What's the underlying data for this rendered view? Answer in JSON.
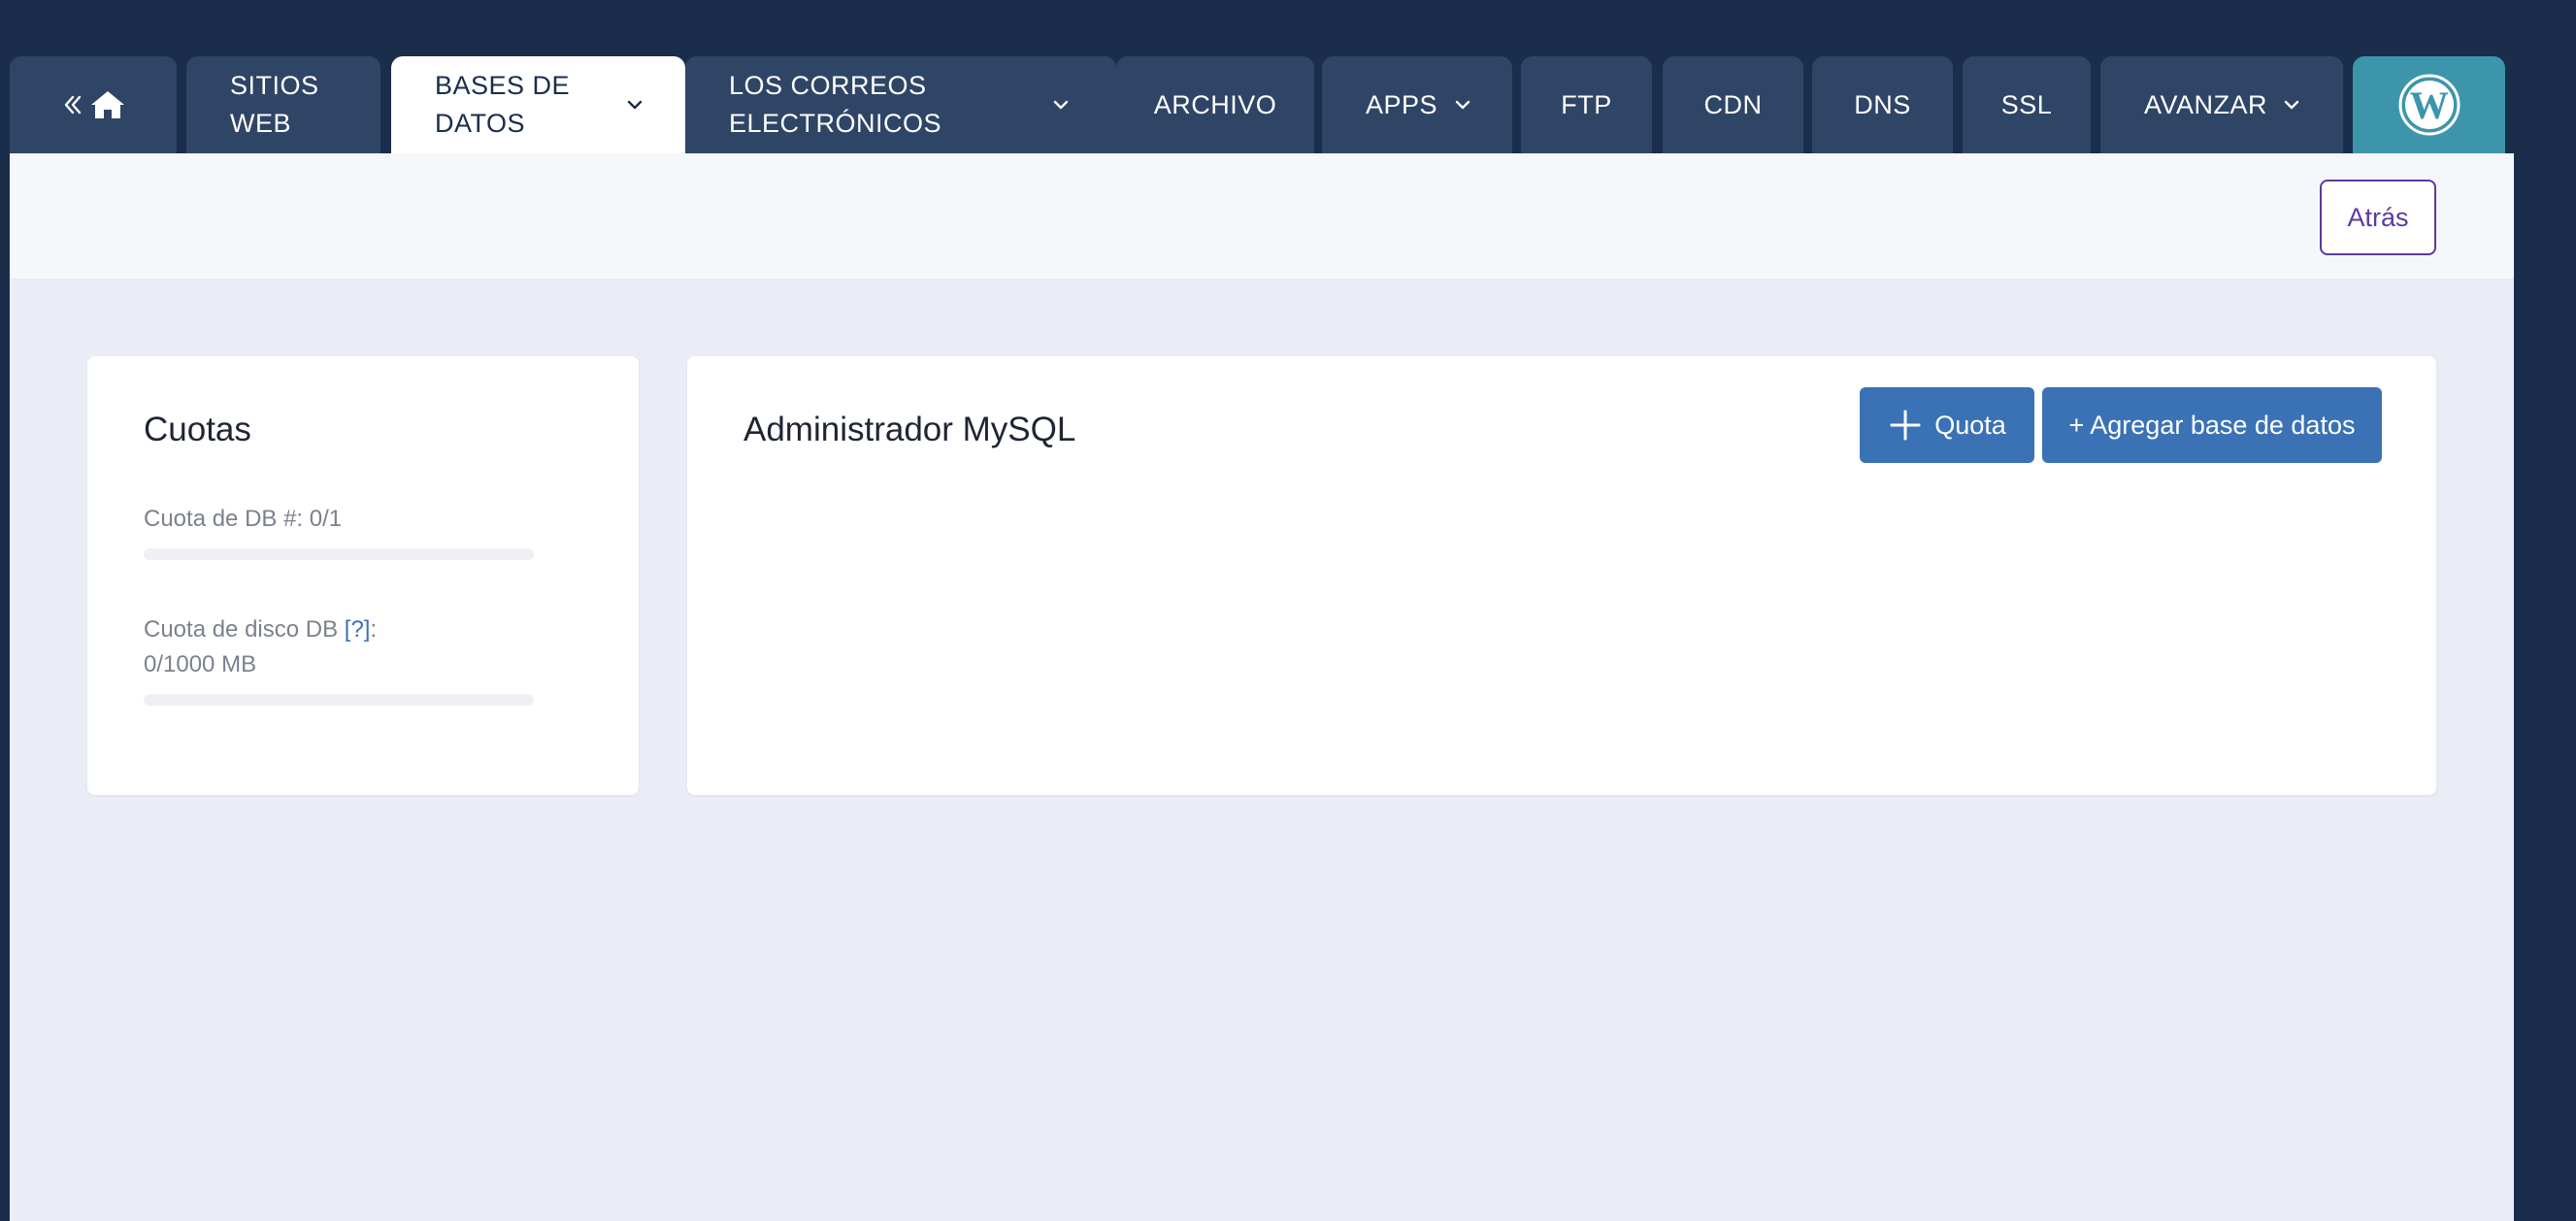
{
  "nav": {
    "tabs": [
      {
        "line1": "SITIOS",
        "line2": "WEB"
      },
      {
        "line1": "BASES DE",
        "line2": "DATOS"
      },
      {
        "line1": "LOS CORREOS",
        "line2": "ELECTRÓNICOS"
      },
      {
        "label": "ARCHIVO"
      },
      {
        "label": "APPS"
      },
      {
        "label": "FTP"
      },
      {
        "label": "CDN"
      },
      {
        "label": "DNS"
      },
      {
        "label": "SSL"
      },
      {
        "label": "AVANZAR"
      }
    ],
    "active_tab": "BASES DE DATOS",
    "home_icon": "home-icon",
    "back_chevrons_icon": "double-chevron-left-icon",
    "wordpress_icon": "wordpress-logo-icon"
  },
  "header": {
    "back_label": "Atrás"
  },
  "quotas": {
    "title": "Cuotas",
    "db_count_label": "Cuota de DB #: 0/1",
    "db_count_progress": 0,
    "disk_label_prefix": "Cuota de disco DB ",
    "disk_help_link": "[?]",
    "disk_label_suffix": ":",
    "disk_value": "0/1000 MB",
    "disk_progress": 0
  },
  "mysql": {
    "title": "Administrador MySQL",
    "quota_button_label": "Quota",
    "add_db_button_label": "+ Agregar base de datos"
  },
  "colors": {
    "background": "#1a2d4b",
    "tab": "#2f4566",
    "tab_active": "#ffffff",
    "wordpress_tab": "#3d95ab",
    "accent_blue": "#3b72b6",
    "back_button_purple": "#5b3a9e"
  }
}
